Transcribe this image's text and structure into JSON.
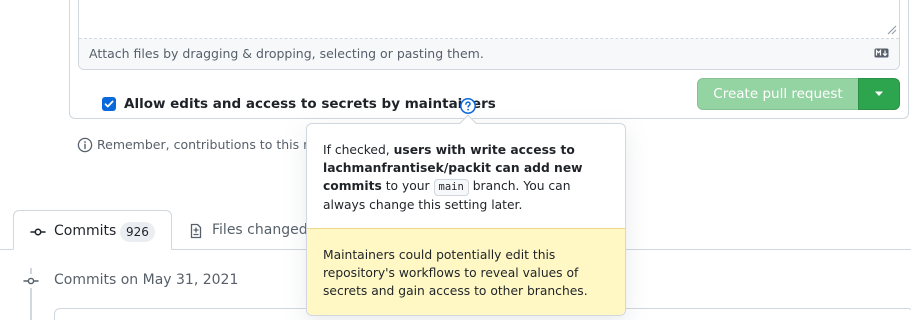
{
  "composer": {
    "attach_hint": "Attach files by dragging & dropping, selecting or pasting them."
  },
  "maintainer_option": {
    "checked": true,
    "label": "Allow edits and access to secrets by maintainers"
  },
  "actions": {
    "create_pr_label": "Create pull request",
    "primary_color": "#2da44e",
    "disabled_color": "#94d3a2"
  },
  "remember": {
    "text": "Remember, contributions to this repo"
  },
  "popover": {
    "intro": "If checked,",
    "bold": "users with write access to lachmanfrantisek/packit can add new commits",
    "to_your": "to your",
    "branch_chip": "main",
    "rest": "branch. You can always change this setting later.",
    "warning": "Maintainers could potentially edit this repository's workflows to reveal values of secrets and gain access to other branches."
  },
  "tabs": [
    {
      "label": "Commits",
      "count": "926",
      "active": true
    },
    {
      "label": "Files changed",
      "active": false
    }
  ],
  "timeline": {
    "commits_date": "Commits on May 31, 2021"
  },
  "icons": {
    "checkbox": "check-icon",
    "help": "question-circle-icon",
    "info": "info-icon",
    "dropdown": "triangle-down-icon",
    "commits": "git-commit-icon",
    "files": "file-diff-icon",
    "markdown": "markdown-icon"
  }
}
